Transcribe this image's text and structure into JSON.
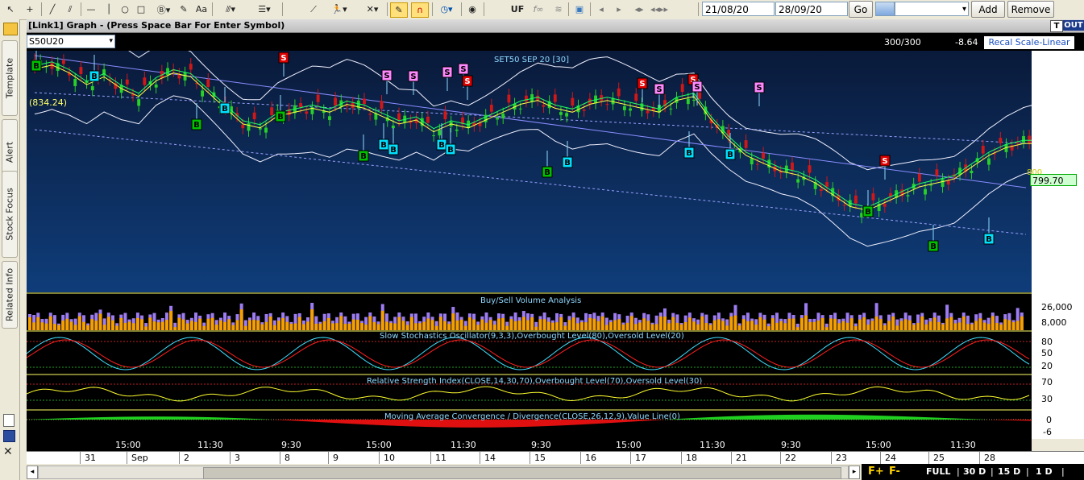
{
  "toolbar": {
    "icons": [
      "cursor-icon",
      "crosshair-icon",
      "line-icon",
      "parallel-icon",
      "hline-icon",
      "circle-icon",
      "rectangle-icon",
      "copyright-icon",
      "text-icon",
      "fibonacci-icon",
      "linestyle-icon",
      "trendline-icon",
      "figure-icon",
      "delete-icon",
      "pencil-icon",
      "magnet-icon",
      "clock-icon",
      "globe-icon",
      "image-icon",
      "arrow-left-icon",
      "arrow-right-icon",
      "pan-icon",
      "zoom-icon"
    ],
    "uf_label": "UF",
    "fx_label": "f∞",
    "aa_label": "Aa",
    "from_date": "21/08/20",
    "to_date": "28/09/20",
    "go_label": "Go",
    "add_label": "Add",
    "remove_label": "Remove"
  },
  "sidebar": {
    "tabs": [
      {
        "label": "Template"
      },
      {
        "label": "Alert"
      },
      {
        "label": "Stock Focus"
      },
      {
        "label": "Related Info"
      }
    ]
  },
  "window": {
    "title": "[Link1] Graph  - (Press Space Bar For Enter Symbol)",
    "t_label": "T",
    "out_label": "OUT"
  },
  "infobar": {
    "symbol": "S50U20",
    "bars": "300/300",
    "change": "-8.64",
    "recal_label": "Recal Scale-Linear"
  },
  "chart_data": [
    {
      "type": "candlestick",
      "title": "SET50 SEP 20   [30]",
      "annotation_level": "(834.24)",
      "last_price": "799.70",
      "axis_label": "800",
      "buy_signals": 18,
      "sell_signals": 14,
      "close_series": [
        840,
        842,
        838,
        832,
        836,
        830,
        826,
        834,
        838,
        836,
        828,
        820,
        812,
        810,
        816,
        818,
        820,
        818,
        822,
        820,
        816,
        812,
        814,
        808,
        812,
        810,
        814,
        818,
        822,
        824,
        820,
        818,
        822,
        824,
        822,
        820,
        818,
        824,
        826,
        814,
        804,
        796,
        792,
        788,
        786,
        782,
        776,
        770,
        768,
        772,
        776,
        780,
        782,
        784,
        790,
        796,
        800,
        802
      ]
    },
    {
      "type": "bar",
      "title": "Buy/Sell Volume Analysis",
      "ticks": [
        "26,000",
        "8,000"
      ]
    },
    {
      "type": "line",
      "title": "Slow Stochastics Oscillator(9,3,3),Overbought Level(80),Oversold Level(20)",
      "ticks": [
        "80",
        "50",
        "20"
      ]
    },
    {
      "type": "line",
      "title": "Relative Strength Index(CLOSE,14,30,70),Overbought Level(70),Oversold Level(30)",
      "ticks": [
        "70",
        "30"
      ]
    },
    {
      "type": "area",
      "title": "Moving Average Convergence / Divergence(CLOSE,26,12,9),Value Line(0)",
      "ticks": [
        "0",
        "-6"
      ]
    }
  ],
  "time_axis": [
    "15:00",
    "11:30",
    "9:30",
    "15:00",
    "11:30",
    "9:30",
    "15:00",
    "11:30",
    "9:30",
    "15:00",
    "11:30"
  ],
  "date_axis": [
    "31",
    "Sep",
    "2",
    "3",
    "8",
    "9",
    "10",
    "11",
    "14",
    "15",
    "16",
    "17",
    "18",
    "21",
    "22",
    "23",
    "24",
    "25",
    "28"
  ],
  "bottombar": {
    "f_plus": "F+",
    "f_minus": "F-",
    "full": "FULL",
    "d30": "30 D",
    "d15": "15 D",
    "d1": "1 D"
  },
  "colors": {
    "buy_green": "#00c000",
    "buy_cyan": "#00e0ff",
    "sell_red": "#e00000",
    "sell_pink": "#ff88ff",
    "chart_top": "#0a1a3a",
    "chart_bottom": "#0f3d7a"
  }
}
